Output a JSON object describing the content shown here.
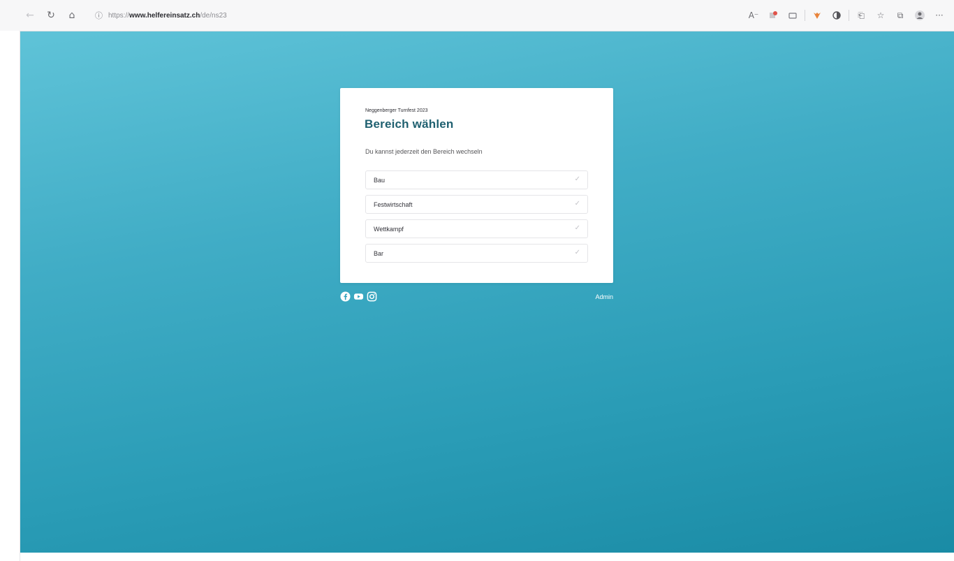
{
  "browser": {
    "url_scheme": "https://",
    "url_host": "www.helfereinsatz.ch",
    "url_path": "/de/ns23",
    "icons": [
      "back-icon",
      "reload-icon",
      "home-icon",
      "lock-icon",
      "read-aloud-icon",
      "extension-icon",
      "extension-icon",
      "extension-icon",
      "extension-icon",
      "split-screen-icon",
      "favorites-icon",
      "collections-icon",
      "profile-icon",
      "more-icon"
    ]
  },
  "card": {
    "eyebrow": "Neggenberger Turnfest 2023",
    "title": "Bereich wählen",
    "description": "Du kannst jederzeit den Bereich wechseln",
    "options": [
      {
        "label": "Bau"
      },
      {
        "label": "Festwirtschaft"
      },
      {
        "label": "Wettkampf"
      },
      {
        "label": "Bar"
      }
    ]
  },
  "footer": {
    "socials": [
      "facebook-icon",
      "youtube-icon",
      "instagram-icon"
    ],
    "admin_label": "Admin"
  },
  "colors": {
    "gradient_top": "#5fc3d8",
    "gradient_bottom": "#1a8ba5",
    "title": "#1f6070"
  }
}
